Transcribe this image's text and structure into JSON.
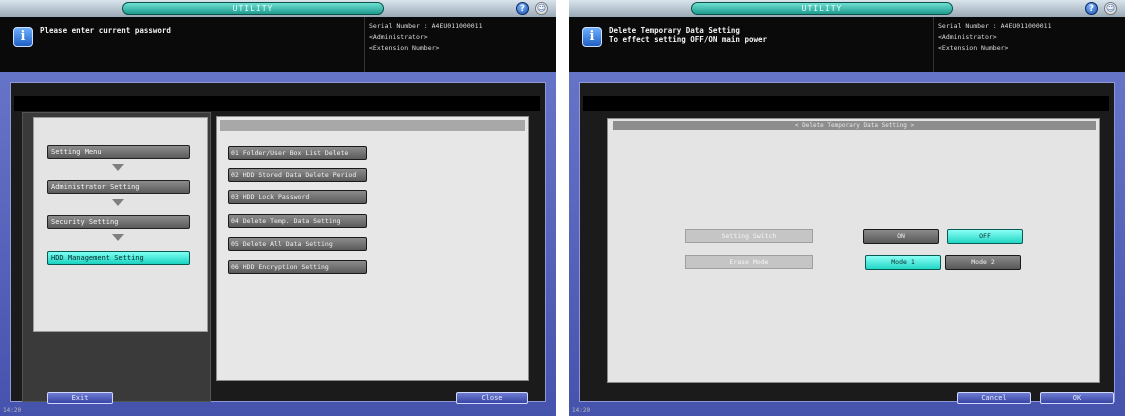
{
  "screens": [
    {
      "title": "UTILITY",
      "message": "Please enter current password",
      "serial": {
        "label": "Serial Number",
        "value": ": A4EU011000011"
      },
      "user": "<Administrator>",
      "extension": "<Extension Number>",
      "menu_path": [
        "Setting Menu",
        "Administrator Setting",
        "Security Setting",
        "HDD Management Setting"
      ],
      "items": [
        "01 Folder/User Box List Delete",
        "02 HDD Stored Data Delete Period",
        "03 HDD Lock Password",
        "04 Delete Temp. Data Setting",
        "05 Delete All Data Setting",
        "06 HDD Encryption Setting"
      ],
      "buttons": {
        "left": "Exit",
        "right": "Close"
      },
      "clock": "14:20"
    },
    {
      "title": "UTILITY",
      "message_lines": [
        "Delete Temporary Data Setting",
        "To effect setting OFF/ON main power"
      ],
      "serial": {
        "label": "Serial Number",
        "value": ": A4EU011000011"
      },
      "user": "<Administrator>",
      "extension": "<Extension Number>",
      "dialog_title": "< Delete Temporary Data Setting >",
      "rows": [
        {
          "label": "Setting Switch",
          "options": [
            "ON",
            "OFF"
          ],
          "selected": "OFF"
        },
        {
          "label": "Erase Mode",
          "options": [
            "Mode 1",
            "Mode 2"
          ],
          "selected": "Mode 1"
        }
      ],
      "buttons": {
        "cancel": "Cancel",
        "ok": "OK"
      },
      "clock": "14:20"
    }
  ],
  "colors": {
    "accent": "#1ad3c1",
    "frame_blue": "#4553ad",
    "background": "#121212"
  },
  "icons": [
    "help-icon",
    "accessibility-icon",
    "info-icon",
    "arrow-down-icon"
  ]
}
